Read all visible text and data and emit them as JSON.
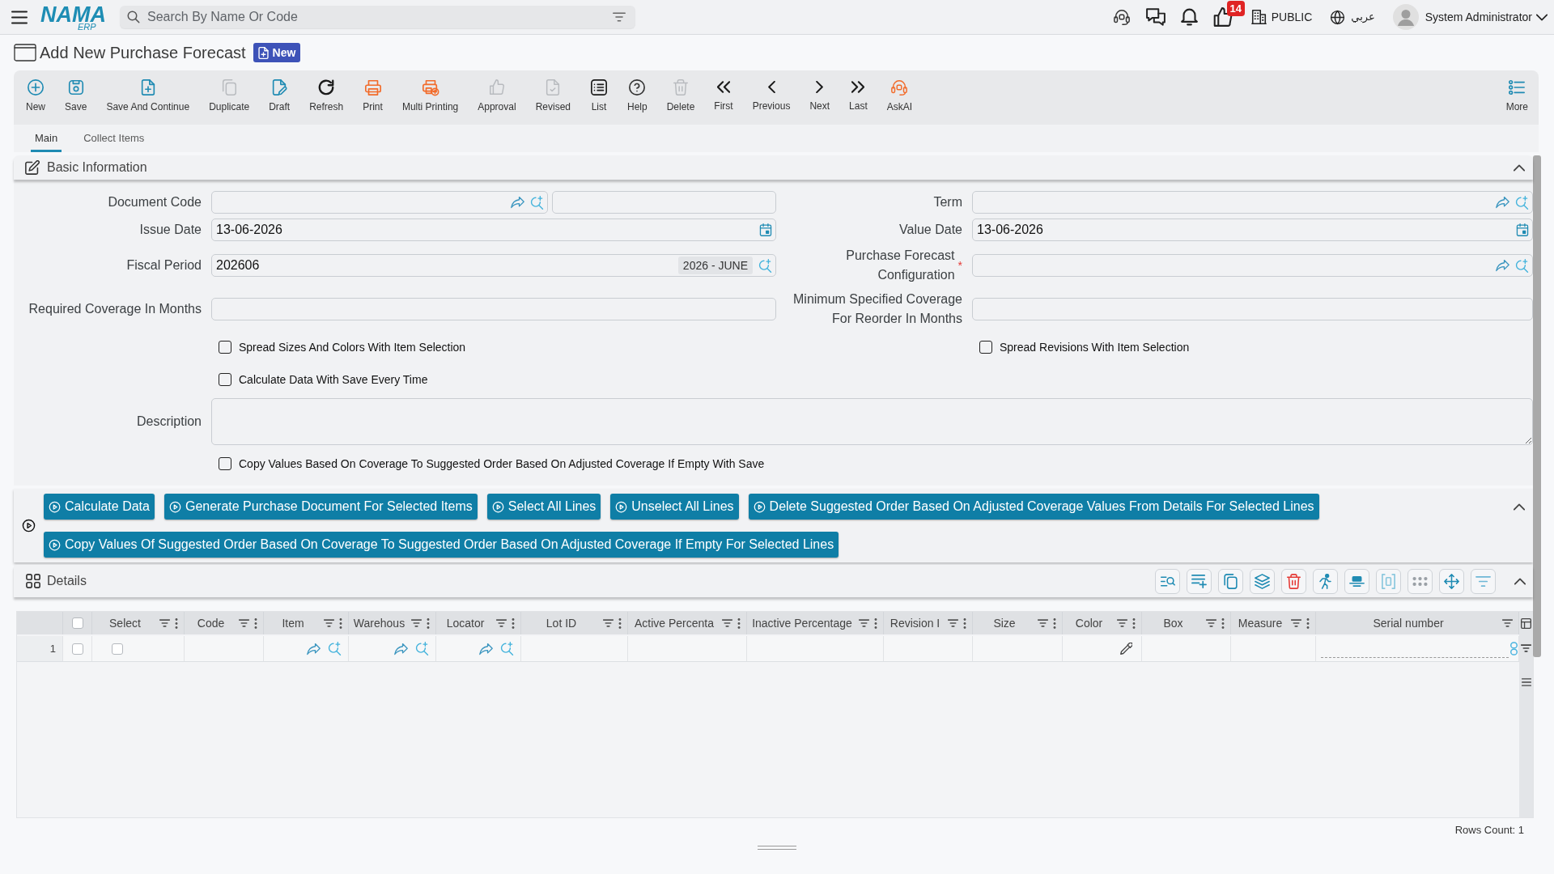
{
  "top_bar": {
    "logo": {
      "name": "NAMA",
      "tagline": "ERP"
    },
    "search": {
      "placeholder": "Search By Name Or Code"
    },
    "notifications_count": "14",
    "company": "PUBLIC",
    "language": "عربي",
    "user": "System Administrator"
  },
  "page": {
    "title": "Add New Purchase Forecast",
    "status": "New"
  },
  "toolbar": {
    "items": [
      {
        "label": "New",
        "disabled": false
      },
      {
        "label": "Save",
        "disabled": false
      },
      {
        "label": "Save And Continue",
        "disabled": false
      },
      {
        "label": "Duplicate",
        "disabled": true
      },
      {
        "label": "Draft",
        "disabled": false
      },
      {
        "label": "Refresh",
        "disabled": false
      },
      {
        "label": "Print",
        "disabled": false
      },
      {
        "label": "Multi Printing",
        "disabled": false
      },
      {
        "label": "Approval",
        "disabled": true
      },
      {
        "label": "Revised",
        "disabled": true
      },
      {
        "label": "List",
        "disabled": false
      },
      {
        "label": "Help",
        "disabled": false
      },
      {
        "label": "Delete",
        "disabled": true
      },
      {
        "label": "First",
        "disabled": false
      },
      {
        "label": "Previous",
        "disabled": false
      },
      {
        "label": "Next",
        "disabled": false
      },
      {
        "label": "Last",
        "disabled": false
      },
      {
        "label": "AskAI",
        "disabled": false
      }
    ],
    "more": {
      "label": "More"
    }
  },
  "tabs": [
    {
      "label": "Main",
      "selected": true
    },
    {
      "label": "Collect Items",
      "selected": false
    }
  ],
  "basic_information": {
    "title": "Basic Information",
    "expanded": true,
    "rows": [
      {
        "left": {
          "kind": "code_lookup",
          "label": "Document Code"
        },
        "right": {
          "kind": "lookup",
          "label": "Term"
        }
      },
      {
        "left": {
          "kind": "date",
          "label": "Issue Date",
          "value": "13-06-2026"
        },
        "right": {
          "kind": "date",
          "label": "Value Date",
          "value": "13-06-2026"
        }
      },
      {
        "left": {
          "kind": "period_lookup",
          "label": "Fiscal Period",
          "value": "202606",
          "tag": "2026 - JUNE"
        },
        "right": {
          "kind": "lookup",
          "label": "Purchase Forecast Configuration",
          "required_mark": "*"
        }
      },
      {
        "left": {
          "kind": "text",
          "label": "Required Coverage In Months"
        },
        "right": {
          "kind": "text",
          "label": "Minimum Specified Coverage For Reorder In Months"
        }
      },
      {
        "left": {
          "kind": "checkbox",
          "label": "Spread Sizes And Colors With Item Selection",
          "checked": false
        },
        "right": {
          "kind": "checkbox",
          "label": "Spread Revisions With Item Selection",
          "checked": false
        }
      },
      {
        "left": {
          "kind": "checkbox",
          "label": "Calculate Data With Save Every Time",
          "checked": false
        }
      },
      {
        "full": {
          "kind": "textarea",
          "label": "Description"
        }
      },
      {
        "full": {
          "kind": "checkbox",
          "label": "Copy Values Based On Coverage To Suggested Order Based On Adjusted Coverage If Empty With Save",
          "checked": false
        }
      }
    ]
  },
  "actions": {
    "expanded": true,
    "buttons": [
      "Calculate Data",
      "Generate Purchase Document For Selected Items",
      "Select All Lines",
      "Unselect All Lines",
      "Delete Suggested Order Based On Adjusted Coverage Values From Details For Selected Lines",
      "Copy Values Of Suggested Order Based On Coverage To Suggested Order Based On Adjusted Coverage If Empty For Selected Lines"
    ]
  },
  "details": {
    "title": "Details",
    "expanded": true,
    "table": {
      "select_all_checked": false,
      "columns": [
        {
          "label": "Select",
          "kind": "checkbox"
        },
        {
          "label": "Code",
          "kind": "text"
        },
        {
          "label": "Item",
          "kind": "lookup"
        },
        {
          "label": "Warehous",
          "kind": "lookup"
        },
        {
          "label": "Locator",
          "kind": "lookup"
        },
        {
          "label": "Lot ID",
          "kind": "text"
        },
        {
          "label": "Active Percenta",
          "kind": "text"
        },
        {
          "label": "Inactive Percentage",
          "kind": "text"
        },
        {
          "label": "Revision I",
          "kind": "text"
        },
        {
          "label": "Size",
          "kind": "text"
        },
        {
          "label": "Color",
          "kind": "color"
        },
        {
          "label": "Box",
          "kind": "text"
        },
        {
          "label": "Measure",
          "kind": "text"
        },
        {
          "label": "Serial number",
          "kind": "serial"
        }
      ],
      "rows": [
        {
          "number": "1",
          "checked": false,
          "select": false
        }
      ]
    },
    "rows_count": "Rows Count: 1"
  }
}
